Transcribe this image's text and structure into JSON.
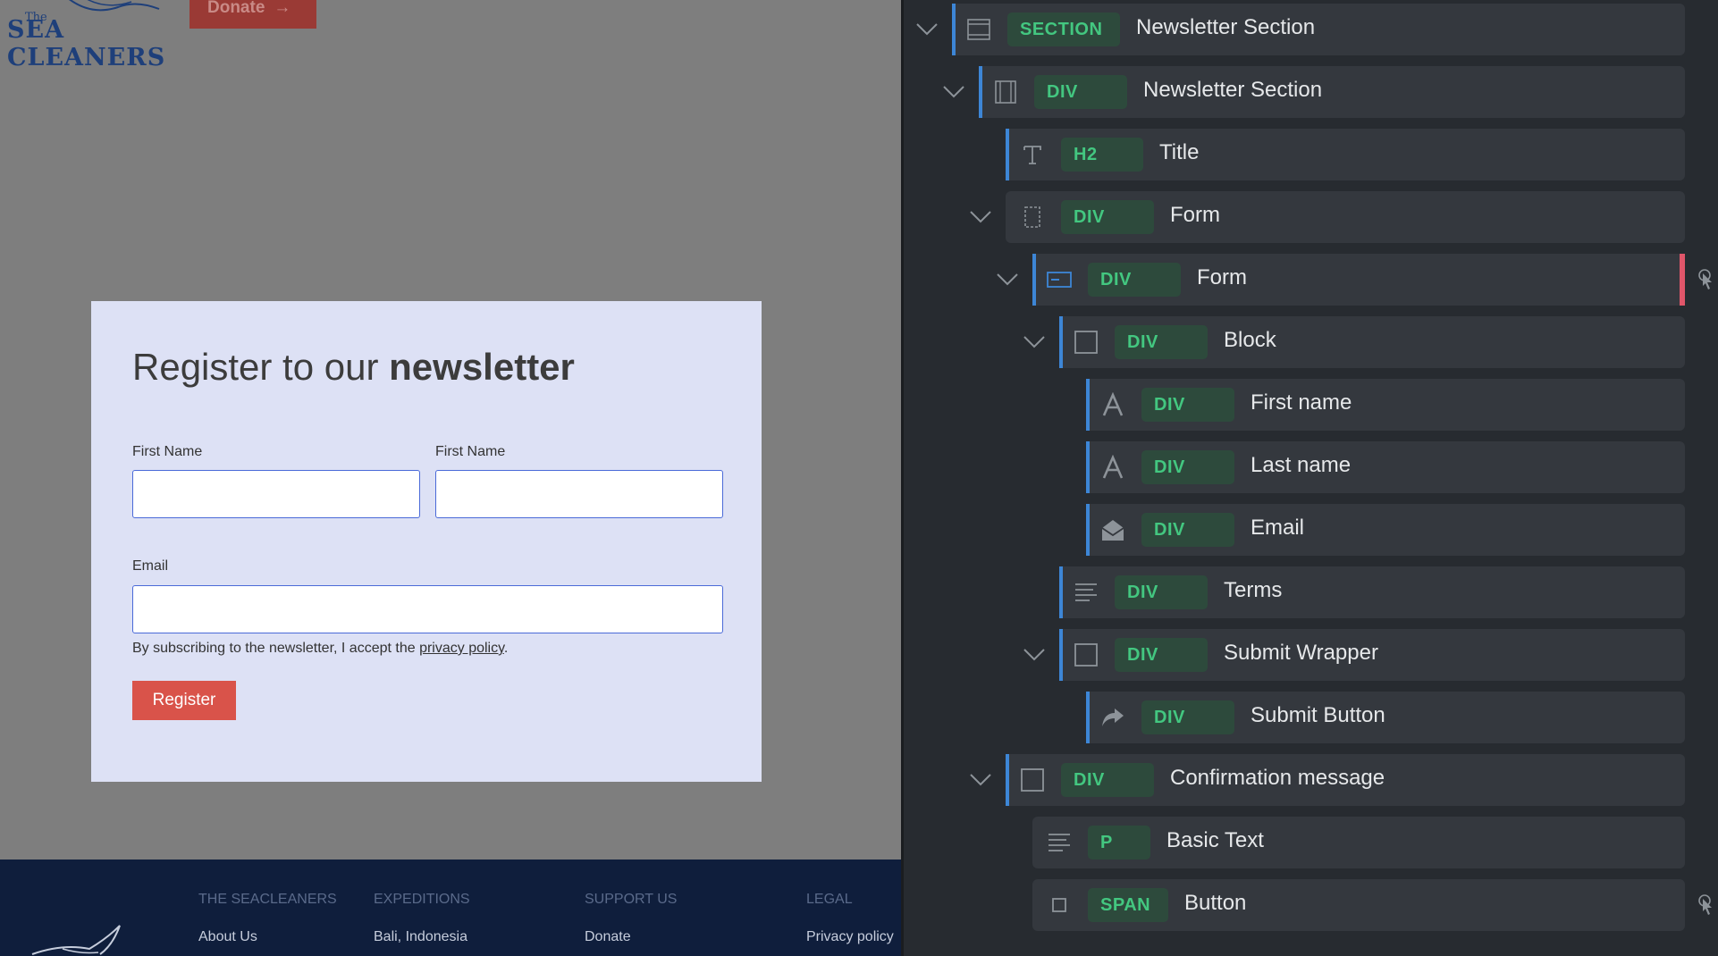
{
  "preview": {
    "logo_small": "The",
    "logo_main": "SEA CLEANERS",
    "donate_label": "Donate",
    "donate_arrow": "→",
    "newsletter": {
      "title_regular": "Register to our ",
      "title_bold": "newsletter",
      "first_label": "First Name",
      "second_label": "First Name",
      "email_label": "Email",
      "first_value": "",
      "second_value": "",
      "email_value": "",
      "terms_text": "By subscribing to the newsletter, I accept the ",
      "terms_link": "privacy policy",
      "terms_end": ".",
      "submit_label": "Register"
    },
    "footer": {
      "columns": [
        {
          "heading": "THE SEACLEANERS",
          "link": "About Us"
        },
        {
          "heading": "EXPEDITIONS",
          "link": "Bali, Indonesia"
        },
        {
          "heading": "SUPPORT US",
          "link": "Donate"
        },
        {
          "heading": "LEGAL",
          "link": "Privacy policy"
        }
      ]
    }
  },
  "layers": [
    {
      "tag": "SECTION",
      "name": "Newsletter Section",
      "icon": "section-icon",
      "collapsible": true
    },
    {
      "tag": "DIV",
      "name": "Newsletter Section",
      "icon": "container-icon",
      "collapsible": true
    },
    {
      "tag": "H2",
      "name": "Title",
      "icon": "text-icon",
      "collapsible": false
    },
    {
      "tag": "DIV",
      "name": "Form",
      "icon": "dashed-box-icon",
      "collapsible": true
    },
    {
      "tag": "DIV",
      "name": "Form",
      "icon": "form-icon",
      "collapsible": true
    },
    {
      "tag": "DIV",
      "name": "Block",
      "icon": "box-icon",
      "collapsible": true
    },
    {
      "tag": "DIV",
      "name": "First name",
      "icon": "text-field-icon",
      "collapsible": false
    },
    {
      "tag": "DIV",
      "name": "Last name",
      "icon": "text-field-icon",
      "collapsible": false
    },
    {
      "tag": "DIV",
      "name": "Email",
      "icon": "envelope-icon",
      "collapsible": false
    },
    {
      "tag": "DIV",
      "name": "Terms",
      "icon": "paragraph-icon",
      "collapsible": false
    },
    {
      "tag": "DIV",
      "name": "Submit Wrapper",
      "icon": "box-icon",
      "collapsible": true
    },
    {
      "tag": "DIV",
      "name": "Submit Button",
      "icon": "share-arrow-icon",
      "collapsible": false
    },
    {
      "tag": "DIV",
      "name": "Confirmation message",
      "icon": "box-icon",
      "collapsible": true
    },
    {
      "tag": "P",
      "name": "Basic Text",
      "icon": "paragraph-icon",
      "collapsible": false
    },
    {
      "tag": "SPAN",
      "name": "Button",
      "icon": "small-box-icon",
      "collapsible": false
    }
  ],
  "colors": {
    "accent_blue": "#3d86d6",
    "tag_green": "#43c780",
    "selected_red": "#e0566a",
    "register_red": "#d9534a",
    "footer_navy": "#0f1e3c"
  }
}
